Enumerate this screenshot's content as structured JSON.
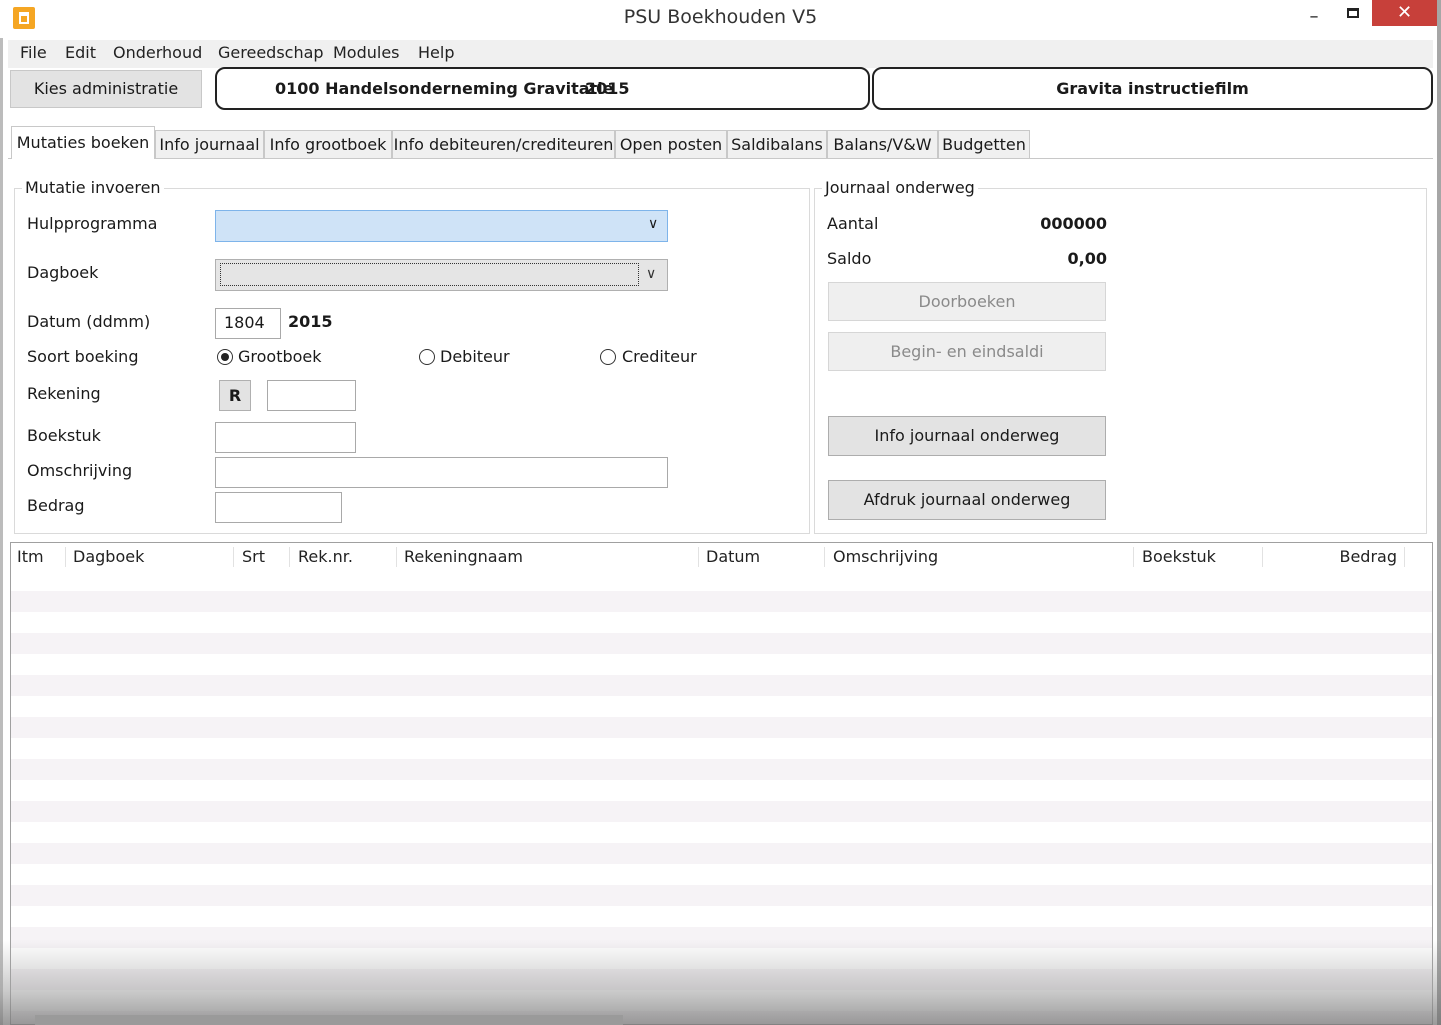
{
  "window": {
    "title": "PSU Boekhouden V5",
    "minimize_glyph": "–",
    "close_glyph": "✕",
    "accent_close": "#c7403a",
    "app_icon": "app-icon"
  },
  "menu": {
    "items": [
      "File",
      "Edit",
      "Onderhoud",
      "Gereedschap",
      "Modules",
      "Help"
    ]
  },
  "toolbar": {
    "kies_label": "Kies administratie",
    "admin_code_name": "0100 Handelsonderneming Gravitatie",
    "admin_year": "2015",
    "film_label": "Gravita instructiefilm"
  },
  "tabs": [
    {
      "label": "Mutaties boeken",
      "active": true
    },
    {
      "label": "Info journaal"
    },
    {
      "label": "Info grootboek"
    },
    {
      "label": "Info debiteuren/crediteuren"
    },
    {
      "label": "Open posten"
    },
    {
      "label": "Saldibalans"
    },
    {
      "label": "Balans/V&W"
    },
    {
      "label": "Budgetten"
    }
  ],
  "mutatie": {
    "group_title": "Mutatie invoeren",
    "hulp_label": "Hulpprogramma",
    "hulp_value": "",
    "dagboek_label": "Dagboek",
    "dagboek_value": "",
    "datum_label": "Datum (ddmm)",
    "datum_value": "1804",
    "datum_year": "2015",
    "soort_label": "Soort boeking",
    "soort_options": [
      "Grootboek",
      "Debiteur",
      "Crediteur"
    ],
    "soort_selected": "Grootboek",
    "rekening_label": "Rekening",
    "rekening_button": "R",
    "rekening_value": "",
    "boekstuk_label": "Boekstuk",
    "boekstuk_value": "",
    "omschrijving_label": "Omschrijving",
    "omschrijving_value": "",
    "bedrag_label": "Bedrag",
    "bedrag_value": "",
    "combo_arrow": "∨"
  },
  "journaal": {
    "group_title": "Journaal onderweg",
    "aantal_label": "Aantal",
    "aantal_value": "000000",
    "saldo_label": "Saldo",
    "saldo_value": "0,00",
    "doorboeken_label": "Doorboeken",
    "saldi_label": "Begin- en eindsaldi",
    "info_label": "Info journaal onderweg",
    "afdruk_label": "Afdruk journaal onderweg"
  },
  "grid": {
    "columns": [
      "Itm",
      "Dagboek",
      "Srt",
      "Rek.nr.",
      "Rekeningnaam",
      "Datum",
      "Omschrijving",
      "Boekstuk",
      "Bedrag"
    ],
    "rows": []
  }
}
